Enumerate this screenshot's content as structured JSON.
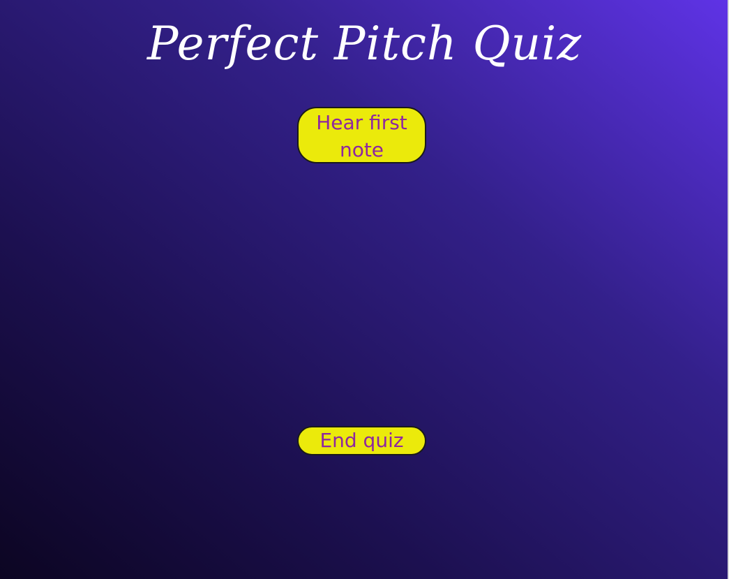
{
  "page": {
    "title": "Perfect Pitch Quiz"
  },
  "buttons": {
    "hear_first_note": "Hear first note",
    "end_quiz": "End quiz"
  },
  "colors": {
    "button_background": "#ebea0b",
    "button_text": "#8e27a0",
    "title_text": "#ffffff",
    "background_dark": "#0c0522",
    "background_light": "#5f33e6"
  }
}
